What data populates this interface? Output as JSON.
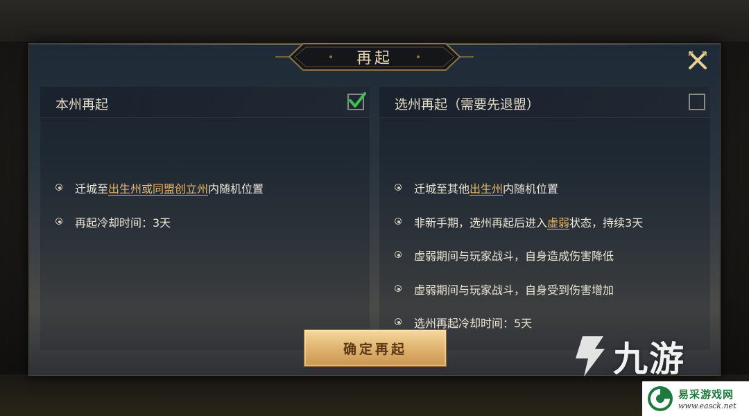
{
  "dialog": {
    "title": "再起",
    "close_icon": "close-x-icon"
  },
  "left_panel": {
    "title": "本州再起",
    "checked": true,
    "items": [
      {
        "parts": [
          "迁城至",
          "出生州或同盟创立州",
          "内随机位置"
        ]
      },
      {
        "parts": [
          "再起冷却时间：3天"
        ]
      }
    ]
  },
  "right_panel": {
    "title": "选州再起（需要先退盟）",
    "checked": false,
    "items": [
      {
        "parts": [
          "迁城至其他",
          "出生州",
          "内随机位置"
        ]
      },
      {
        "parts": [
          "非新手期，选州再起后进入",
          "虚弱",
          "状态，持续3天"
        ]
      },
      {
        "parts": [
          "虚弱期间与玩家战斗，自身造成伤害降低"
        ]
      },
      {
        "parts": [
          "虚弱期间与玩家战斗，自身受到伤害增加"
        ]
      },
      {
        "parts": [
          "选州再起冷却时间：5天"
        ]
      }
    ]
  },
  "confirm_button": {
    "label": "确定再起"
  },
  "watermarks": {
    "nine_game": "九游",
    "easck_cn": "易采游戏网",
    "easck_url": "www.easck.net"
  },
  "colors": {
    "highlight": "#e8b86a",
    "check_green": "#3fbf4f",
    "button_gold": "#e2b774"
  }
}
